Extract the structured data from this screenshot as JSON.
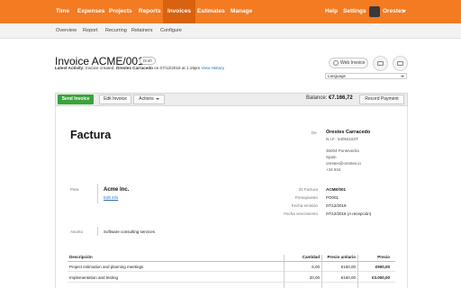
{
  "topnav": {
    "items": [
      "Time",
      "Expenses",
      "Projects",
      "Reports",
      "Invoices",
      "Estimates",
      "Manage"
    ],
    "active": "Invoices",
    "help": "Help",
    "settings": "Settings",
    "user": "Orestes"
  },
  "subnav": {
    "items": [
      "Overview",
      "Report",
      "Recurring",
      "Retainers",
      "Configure"
    ]
  },
  "invoice": {
    "title": "Invoice ACME/001",
    "status": "Draft",
    "activity_label": "Latest Activity:",
    "activity_text": "Invoice created.",
    "activity_user": "Orestes Carracedo",
    "activity_date": "on 07/12/2018 at 1:19pm",
    "history_link": "View History"
  },
  "tools": {
    "web_invoice": "Web Invoice",
    "language_placeholder": "Language"
  },
  "actions": {
    "send": "Send Invoice",
    "edit": "Edit Invoice",
    "more": "Actions",
    "balance_label": "Balance:",
    "balance_value": "€7.166,72",
    "record_payment": "Record Payment"
  },
  "document": {
    "heading": "Factura",
    "from_label": "De",
    "from_name": "Orestes Carracedo",
    "from_lines": [
      "N.I.F.: 54054163T",
      "",
      "36004 Pontevedra",
      "Spain",
      "orestes@orestes.io",
      "+34 634"
    ],
    "to_label": "Para",
    "client_name": "Acme Inc.",
    "edit_info": "Edit info",
    "meta": [
      {
        "label": "ID Factura",
        "value": "ACME/001",
        "bold": true
      },
      {
        "label": "Presupuesto",
        "value": "PO001",
        "bold": false
      },
      {
        "label": "Fecha emisión",
        "value": "07/12/2018",
        "bold": false
      },
      {
        "label": "Fecha vencimiento",
        "value": "07/12/2018 (A recepción)",
        "bold": false
      }
    ],
    "subject_label": "Asunto",
    "subject": "Software consulting services"
  },
  "table": {
    "headers": [
      "Descripción",
      "Cantidad",
      "Precio unitario",
      "Precio"
    ],
    "rows": [
      [
        "Project estimation and planning meetings",
        "6,00",
        "€150,00",
        "€900,00"
      ],
      [
        "Implementation and testing",
        "20,00",
        "€150,00",
        "€3.000,00"
      ]
    ]
  }
}
